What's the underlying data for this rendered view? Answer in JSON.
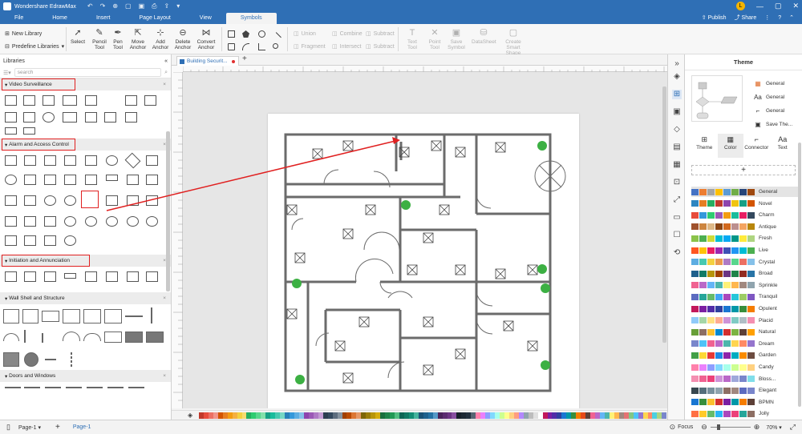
{
  "app": {
    "title": "Wondershare EdrawMax",
    "avatar_letter": "L"
  },
  "titlebar_icons": [
    "undo-icon",
    "redo-icon",
    "new-icon",
    "open-icon",
    "save-icon",
    "print-icon",
    "export-icon",
    "more-icon"
  ],
  "menu": {
    "tabs": [
      "File",
      "Home",
      "Insert",
      "Page Layout",
      "View",
      "Symbols"
    ],
    "active": "Symbols",
    "publish": "Publish",
    "share": "Share"
  },
  "ribbon": {
    "new_library": "New Library",
    "predefine_libraries": "Predefine Libraries",
    "tools": [
      {
        "label": "Select",
        "icon": "cursor"
      },
      {
        "label": "Pencil Tool",
        "icon": "pencil"
      },
      {
        "label": "Pen Tool",
        "icon": "pen"
      },
      {
        "label": "Move Anchor",
        "icon": "move-anchor"
      },
      {
        "label": "Add Anchor",
        "icon": "add-anchor"
      },
      {
        "label": "Delete Anchor",
        "icon": "delete-anchor"
      },
      {
        "label": "Convert Anchor",
        "icon": "convert-anchor"
      }
    ],
    "boolean_ops": [
      "Union",
      "Combine",
      "Subtract",
      "Fragment",
      "Intersect",
      "Subtract"
    ],
    "disabled_tools": [
      {
        "label": "Text Tool",
        "icon": "text"
      },
      {
        "label": "Point Tool",
        "icon": "point"
      },
      {
        "label": "Save Symbol",
        "icon": "save-symbol"
      },
      {
        "label": "DataSheet",
        "icon": "datasheet"
      },
      {
        "label": "Create Smart Shape",
        "icon": "smart-shape"
      }
    ]
  },
  "libraries": {
    "header": "Libraries",
    "search_placeholder": "search",
    "categories": [
      {
        "name": "Video Surveillance",
        "highlighted": true
      },
      {
        "name": "Alarm and Access Control",
        "highlighted": true
      },
      {
        "name": "Initiation and Annunciation",
        "highlighted": true
      },
      {
        "name": "Wall Shell and Structure",
        "highlighted": false
      },
      {
        "name": "Doors and Windows",
        "highlighted": false
      }
    ]
  },
  "document": {
    "tab_label": "Building Securit..."
  },
  "theme": {
    "title": "Theme",
    "options": [
      {
        "label": "General",
        "icon": "palette"
      },
      {
        "label": "General",
        "icon": "font"
      },
      {
        "label": "General",
        "icon": "connector"
      },
      {
        "label": "Save The...",
        "icon": "save"
      }
    ],
    "tabs": [
      {
        "label": "Theme",
        "icon": "grid"
      },
      {
        "label": "Color",
        "icon": "table"
      },
      {
        "label": "Connector",
        "icon": "connector"
      },
      {
        "label": "Text",
        "icon": "text"
      }
    ],
    "active_tab": "Color",
    "palettes": [
      {
        "name": "General",
        "colors": [
          "#4472c4",
          "#ed7d31",
          "#a5a5a5",
          "#ffc000",
          "#5b9bd5",
          "#70ad47",
          "#264478",
          "#9e480e",
          "#636363",
          "#997300"
        ]
      },
      {
        "name": "Novel",
        "colors": [
          "#2e86c1",
          "#e67e22",
          "#27ae60",
          "#c0392b",
          "#8e44ad",
          "#f1c40f",
          "#16a085",
          "#d35400",
          "#2c3e50",
          "#7f8c8d"
        ]
      },
      {
        "name": "Charm",
        "colors": [
          "#e74c3c",
          "#3498db",
          "#2ecc71",
          "#9b59b6",
          "#f39c12",
          "#1abc9c",
          "#e91e63",
          "#34495e",
          "#ff9800",
          "#607d8b"
        ]
      },
      {
        "name": "Antique",
        "colors": [
          "#a0522d",
          "#cd853f",
          "#deb887",
          "#8b4513",
          "#d2691e",
          "#bc8f8f",
          "#f4a460",
          "#b8860b",
          "#daa520",
          "#6b8e23"
        ]
      },
      {
        "name": "Fresh",
        "colors": [
          "#8bc34a",
          "#4caf50",
          "#cddc39",
          "#00bcd4",
          "#03a9f4",
          "#009688",
          "#ffeb3b",
          "#aed581",
          "#81c784",
          "#4dd0e1"
        ]
      },
      {
        "name": "Live",
        "colors": [
          "#ff5722",
          "#ffc107",
          "#e91e63",
          "#9c27b0",
          "#3f51b5",
          "#2196f3",
          "#00bcd4",
          "#4caf50",
          "#ff9800",
          "#795548"
        ]
      },
      {
        "name": "Crystal",
        "colors": [
          "#5dade2",
          "#48c9b0",
          "#f4d03f",
          "#eb984e",
          "#af7ac5",
          "#58d68d",
          "#ec7063",
          "#85c1e9",
          "#f8c471",
          "#76d7c4"
        ]
      },
      {
        "name": "Broad",
        "colors": [
          "#1f618d",
          "#117a65",
          "#b7950b",
          "#a04000",
          "#6c3483",
          "#1e8449",
          "#922b21",
          "#2874a6",
          "#b9770e",
          "#148f77"
        ]
      },
      {
        "name": "Sprinkle",
        "colors": [
          "#f06292",
          "#ba68c8",
          "#64b5f6",
          "#4db6ac",
          "#fff176",
          "#ffb74d",
          "#a1887f",
          "#90a4ae",
          "#e57373",
          "#81c784"
        ]
      },
      {
        "name": "Tranquil",
        "colors": [
          "#5c6bc0",
          "#26a69a",
          "#66bb6a",
          "#42a5f5",
          "#ab47bc",
          "#26c6da",
          "#9ccc65",
          "#7e57c2",
          "#29b6f6",
          "#8d6e63"
        ]
      },
      {
        "name": "Opulent",
        "colors": [
          "#c2185b",
          "#7b1fa2",
          "#512da8",
          "#303f9f",
          "#1976d2",
          "#0097a7",
          "#388e3c",
          "#f57c00",
          "#e64a19",
          "#5d4037"
        ]
      },
      {
        "name": "Placid",
        "colors": [
          "#90caf9",
          "#a5d6a7",
          "#ffe082",
          "#ffab91",
          "#ce93d8",
          "#80cbc4",
          "#b0bec5",
          "#f48fb1",
          "#9fa8da",
          "#c5e1a5"
        ]
      },
      {
        "name": "Natural",
        "colors": [
          "#689f38",
          "#8d6e63",
          "#fbc02d",
          "#0288d1",
          "#d32f2f",
          "#7cb342",
          "#5d4037",
          "#ffa000",
          "#00796b",
          "#afb42b"
        ]
      },
      {
        "name": "Dream",
        "colors": [
          "#7986cb",
          "#4fc3f7",
          "#f06292",
          "#ba68c8",
          "#4db6ac",
          "#ffd54f",
          "#ff8a65",
          "#9575cd",
          "#4dd0e1",
          "#aed581"
        ]
      },
      {
        "name": "Garden",
        "colors": [
          "#43a047",
          "#fdd835",
          "#e53935",
          "#1e88e5",
          "#8e24aa",
          "#00acc1",
          "#fb8c00",
          "#6d4c41",
          "#c0ca33",
          "#3949ab"
        ]
      },
      {
        "name": "Candy",
        "colors": [
          "#ff80ab",
          "#ea80fc",
          "#8c9eff",
          "#80d8ff",
          "#a7ffeb",
          "#ccff90",
          "#ffff8d",
          "#ffd180",
          "#ff9e80",
          "#b388ff"
        ]
      },
      {
        "name": "Bloss...",
        "colors": [
          "#f48fb1",
          "#f06292",
          "#ec407a",
          "#ce93d8",
          "#ba68c8",
          "#9fa8da",
          "#7986cb",
          "#80deea",
          "#4dd0e1",
          "#a5d6a7"
        ]
      },
      {
        "name": "Elegant",
        "colors": [
          "#37474f",
          "#546e7a",
          "#78909c",
          "#90a4ae",
          "#8d6e63",
          "#a1887f",
          "#5c6bc0",
          "#7986cb",
          "#26a69a",
          "#4db6ac"
        ]
      },
      {
        "name": "BPMN",
        "colors": [
          "#1976d2",
          "#388e3c",
          "#fbc02d",
          "#d32f2f",
          "#7b1fa2",
          "#0097a7",
          "#f57c00",
          "#5d4037",
          "#455a64",
          "#c2185b"
        ]
      },
      {
        "name": "Jolly",
        "colors": [
          "#ff7043",
          "#ffca28",
          "#66bb6a",
          "#29b6f6",
          "#ab47bc",
          "#ec407a",
          "#26a69a",
          "#8d6e63",
          "#5c6bc0",
          "#d4e157"
        ]
      }
    ]
  },
  "statusbar": {
    "page_select": "Page-1",
    "page_tab": "Page-1",
    "focus": "Focus",
    "zoom": "70%"
  },
  "colors": {
    "brand": "#2f6fb5",
    "highlight": "#e02020",
    "annotation_arrow": "#e02020",
    "wall": "#6b6b6b",
    "plant": "#3cb043"
  },
  "bottom_palette": [
    "#c0392b",
    "#e74c3c",
    "#ec7063",
    "#f1948a",
    "#d35400",
    "#e67e22",
    "#f39c12",
    "#f5b041",
    "#f4d03f",
    "#f7dc6f",
    "#27ae60",
    "#2ecc71",
    "#58d68d",
    "#82e0aa",
    "#16a085",
    "#1abc9c",
    "#48c9b0",
    "#76d7c4",
    "#2980b9",
    "#3498db",
    "#5dade2",
    "#85c1e9",
    "#8e44ad",
    "#9b59b6",
    "#af7ac5",
    "#c39bd3",
    "#2c3e50",
    "#34495e",
    "#5d6d7e",
    "#85929e",
    "#a04000",
    "#ba4a00",
    "#dc7633",
    "#e59866",
    "#7d6608",
    "#9a7d0a",
    "#b7950b",
    "#d4ac0d",
    "#196f3d",
    "#1e8449",
    "#229954",
    "#52be80",
    "#0e6655",
    "#117864",
    "#138d75",
    "#45b39d",
    "#1a5276",
    "#1f618d",
    "#2471a3",
    "#5499c7",
    "#4a235a",
    "#5b2c6f",
    "#6c3483",
    "#884ea0",
    "#17202a",
    "#1c2833",
    "#212f3d",
    "#566573",
    "#ff80ab",
    "#ea80fc",
    "#8c9eff",
    "#80d8ff",
    "#a7ffeb",
    "#ccff90",
    "#ffff8d",
    "#ffd180",
    "#ff9e80",
    "#b388ff",
    "#90a4ae",
    "#bdbdbd",
    "#e0e0e0",
    "#ffffff",
    "#c2185b",
    "#7b1fa2",
    "#512da8",
    "#303f9f",
    "#1976d2",
    "#0097a7",
    "#388e3c",
    "#f57c00",
    "#e64a19",
    "#5d4037",
    "#f06292",
    "#ba68c8",
    "#64b5f6",
    "#4db6ac",
    "#fff176",
    "#ffb74d",
    "#a1887f",
    "#e57373",
    "#81c784",
    "#4fc3f7",
    "#9575cd",
    "#ffd54f",
    "#ff8a65",
    "#4dd0e1",
    "#aed581",
    "#7986cb"
  ]
}
